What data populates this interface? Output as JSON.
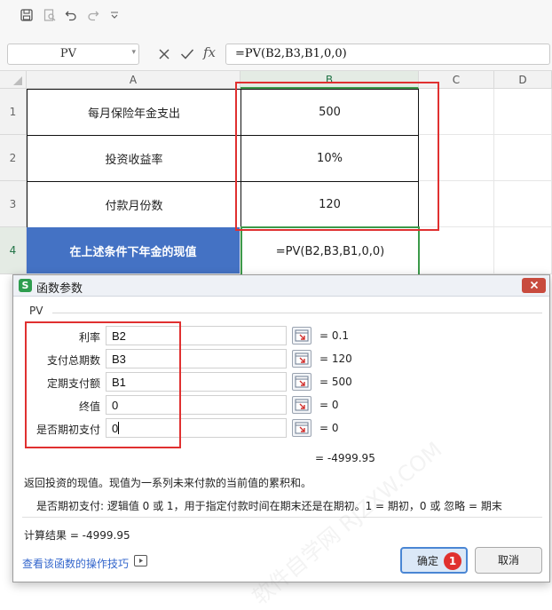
{
  "colors": {
    "accent_green": "#3c9a4a",
    "header_blue": "#4472c4",
    "highlight_red": "#e03030",
    "badge_red": "#e0302e",
    "link_blue": "#3366cc"
  },
  "toolbar": {
    "icons": [
      "save-icon",
      "print-preview-icon",
      "undo-icon",
      "redo-icon",
      "customize-dropdown-icon"
    ]
  },
  "formula_bar": {
    "name_box": "PV",
    "fx_label": "fx",
    "formula": "=PV(B2,B3,B1,0,0)"
  },
  "grid": {
    "columns": [
      "A",
      "B",
      "C",
      "D"
    ],
    "rows": [
      "1",
      "2",
      "3",
      "4"
    ],
    "cells": {
      "a1": "每月保险年金支出",
      "b1": "500",
      "a2": "投资收益率",
      "b2": "10%",
      "a3": "付款月份数",
      "b3": "120",
      "a4": "在上述条件下年金的现值",
      "b4": "=PV(B2,B3,B1,0,0)"
    }
  },
  "dialog": {
    "title": "函数参数",
    "function_name": "PV",
    "params": [
      {
        "label": "利率",
        "value": "B2",
        "result": "= 0.1"
      },
      {
        "label": "支付总期数",
        "value": "B3",
        "result": "= 120"
      },
      {
        "label": "定期支付额",
        "value": "B1",
        "result": "= 500"
      },
      {
        "label": "终值",
        "value": "0",
        "result": "= 0"
      },
      {
        "label": "是否期初支付",
        "value": "0",
        "result": "= 0"
      }
    ],
    "total_result": "= -4999.95",
    "description": "返回投资的现值。现值为一系列未来付款的当前值的累积和。",
    "param_description": "是否期初支付:  逻辑值 0 或 1，用于指定付款时间在期末还是在期初。1 = 期初，0 或 忽略 = 期末",
    "calc_result": "计算结果  =  -4999.95",
    "help_link": "查看该函数的操作技巧",
    "ok_label": "确定",
    "cancel_label": "取消",
    "badge": "1",
    "watermark": "软件自学网 RJZXW.COM"
  }
}
